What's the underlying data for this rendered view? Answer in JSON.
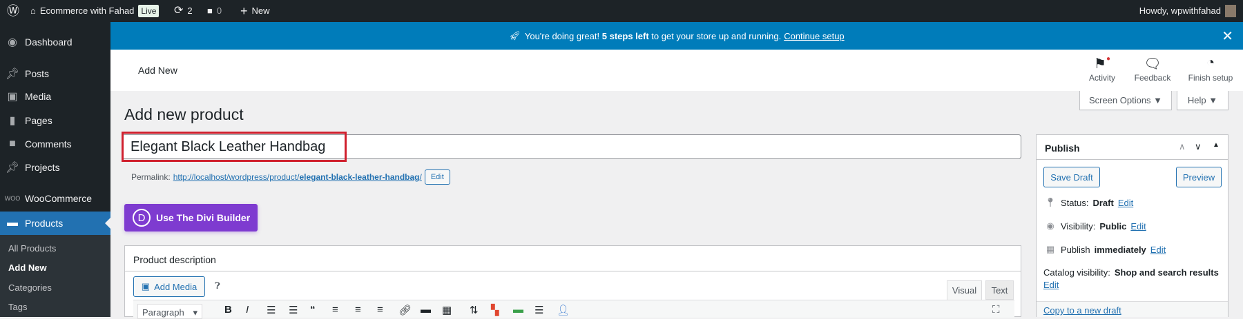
{
  "adminbar": {
    "site_name": "Ecommerce with Fahad",
    "live_badge": "Live",
    "updates_count": "2",
    "comments_count": "0",
    "new_label": "New",
    "howdy": "Howdy, wpwithfahad"
  },
  "sidebar": {
    "items": [
      {
        "label": "Dashboard"
      },
      {
        "label": "Posts"
      },
      {
        "label": "Media"
      },
      {
        "label": "Pages"
      },
      {
        "label": "Comments"
      },
      {
        "label": "Projects"
      },
      {
        "label": "WooCommerce"
      },
      {
        "label": "Products"
      }
    ],
    "submenu": [
      {
        "label": "All Products"
      },
      {
        "label": "Add New"
      },
      {
        "label": "Categories"
      },
      {
        "label": "Tags"
      }
    ]
  },
  "notice": {
    "prefix": "You're doing great!",
    "bold": "5 steps left",
    "suffix": "to get your store up and running.",
    "link": "Continue setup"
  },
  "header": {
    "title": "Add New",
    "activity": "Activity",
    "feedback": "Feedback",
    "finish_setup": "Finish setup"
  },
  "screen_options": "Screen Options ▼",
  "help": "Help ▼",
  "page_title": "Add new product",
  "product_title": "Elegant Black Leather Handbag",
  "permalink": {
    "label": "Permalink:",
    "url_base": "http://localhost/wordpress/product/",
    "slug": "elegant-black-leather-handbag",
    "trail": "/",
    "edit": "Edit"
  },
  "divi_button": "Use The Divi Builder",
  "description": {
    "title": "Product description",
    "add_media": "Add Media",
    "visual_tab": "Visual",
    "text_tab": "Text",
    "format_select": "Paragraph"
  },
  "publish": {
    "title": "Publish",
    "save_draft": "Save Draft",
    "preview": "Preview",
    "status_label": "Status:",
    "status_value": "Draft",
    "visibility_label": "Visibility:",
    "visibility_value": "Public",
    "publish_label": "Publish",
    "publish_value": "immediately",
    "catalog_label": "Catalog visibility:",
    "catalog_value": "Shop and search results",
    "edit": "Edit",
    "copy_draft": "Copy to a new draft"
  }
}
